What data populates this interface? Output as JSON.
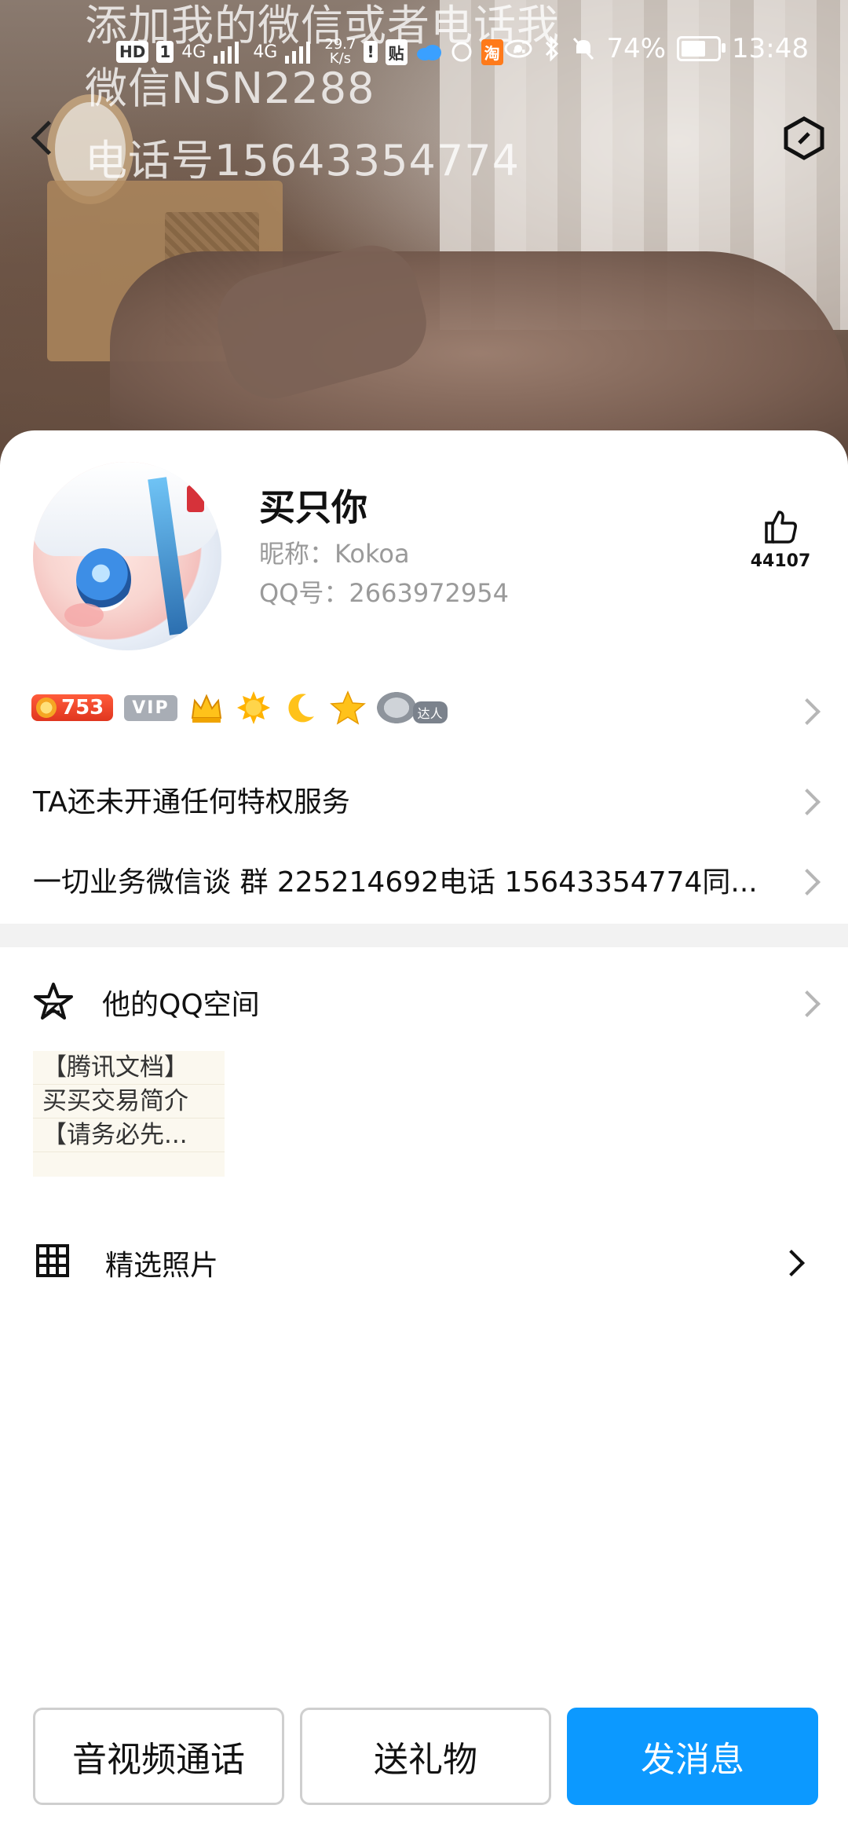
{
  "status_bar": {
    "hd_badge": "HD",
    "sim_badge": "1",
    "network_1": "4G",
    "network_2": "4G",
    "speed_value": "29.7",
    "speed_unit": "K/s",
    "tieba_badge": "贴",
    "taobao_badge": "淘",
    "more": "··",
    "battery_percent": "74%",
    "battery_level": 0.74,
    "time": "13:48"
  },
  "cover": {
    "overlay_line_1": "添加我的微信或者电话我",
    "overlay_line_2": "微信NSN2288",
    "overlay_line_3": "电话号15643354774"
  },
  "profile": {
    "name": "买只你",
    "nickname": "昵称：Kokoa",
    "qq_number": "QQ号：2663972954",
    "like_count": "44107"
  },
  "badges": {
    "level": "753",
    "vip": "VIP",
    "daren": "达人"
  },
  "rows": {
    "privilege": "TA还未开通任何特权服务",
    "signature": "一切业务微信谈 群 225214692电话 15643354774同..."
  },
  "qzone": {
    "title": "他的QQ空间",
    "preview_lines": [
      "【腾讯文档】",
      "买买交易简介",
      "【请务必先..."
    ]
  },
  "photos": {
    "title": "精选照片"
  },
  "actions": {
    "call": "音视频通话",
    "gift": "送礼物",
    "message": "发消息"
  },
  "colors": {
    "primary_button": "#0c99ff",
    "level_badge": "#e0361f",
    "vip_badge": "#a8adb5"
  }
}
